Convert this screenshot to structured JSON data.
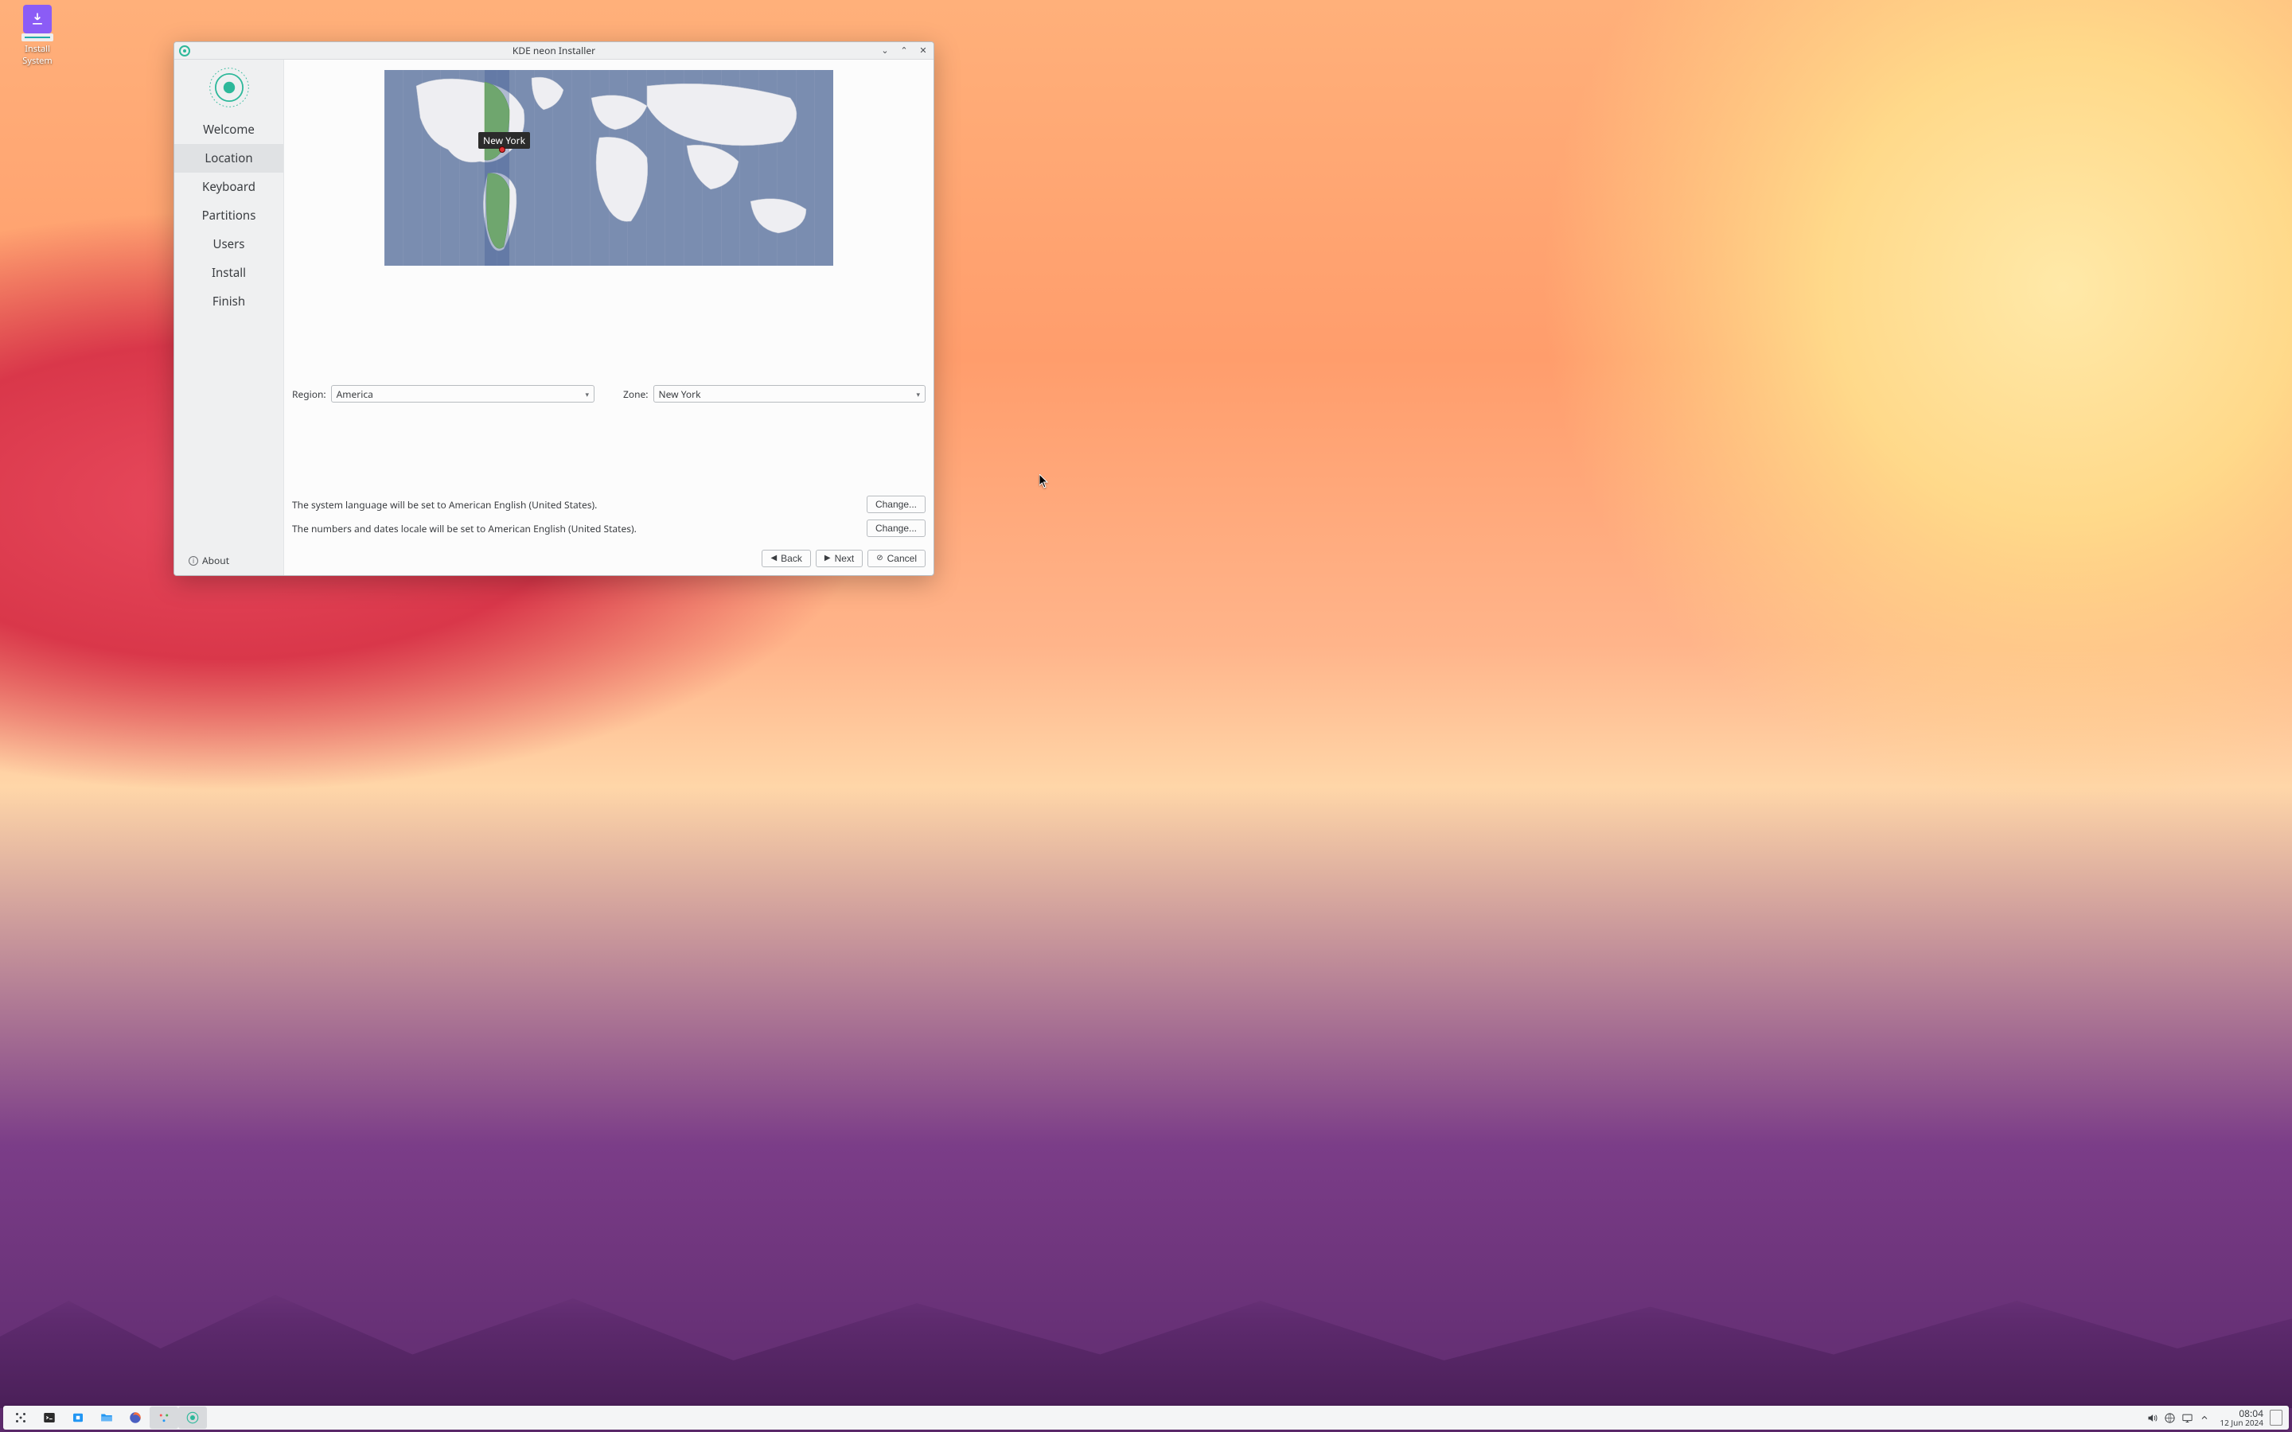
{
  "desktop": {
    "icon_label": "Install System"
  },
  "taskbar": {
    "time": "08:04",
    "date": "12 Jun 2024"
  },
  "window": {
    "title": "KDE neon Installer"
  },
  "sidebar": {
    "steps": [
      {
        "label": "Welcome"
      },
      {
        "label": "Location"
      },
      {
        "label": "Keyboard"
      },
      {
        "label": "Partitions"
      },
      {
        "label": "Users"
      },
      {
        "label": "Install"
      },
      {
        "label": "Finish"
      }
    ],
    "active_index": 1,
    "about_label": "About"
  },
  "location": {
    "city_label": "New York",
    "region_label": "Region:",
    "region_value": "America",
    "zone_label": "Zone:",
    "zone_value": "New York"
  },
  "locale": {
    "language_text": "The system language will be set to American English (United States).",
    "numbers_text": "The numbers and dates locale will be set to American English (United States).",
    "change_label": "Change..."
  },
  "nav": {
    "back_label": "Back",
    "next_label": "Next",
    "cancel_label": "Cancel"
  }
}
